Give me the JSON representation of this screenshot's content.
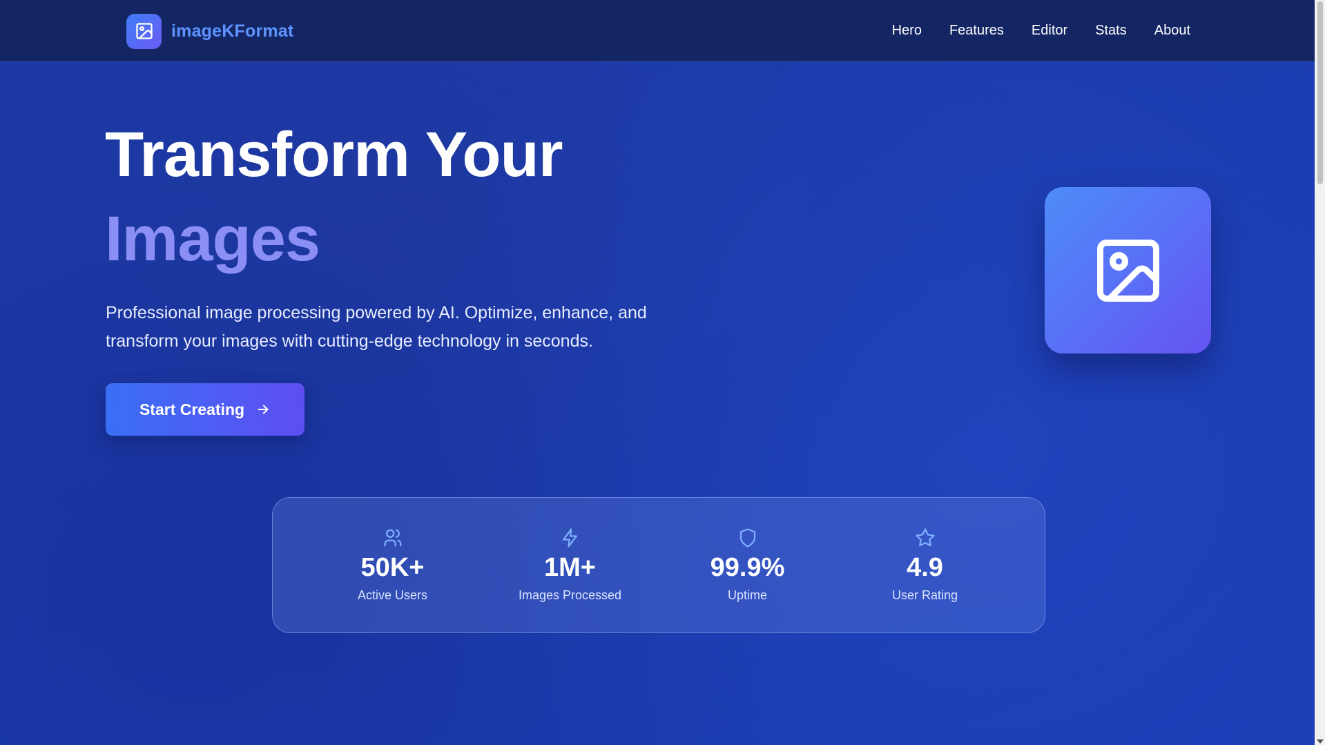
{
  "brand": {
    "name": "imageKFormat",
    "logo_icon": "image-icon"
  },
  "nav": {
    "items": [
      {
        "label": "Hero"
      },
      {
        "label": "Features"
      },
      {
        "label": "Editor"
      },
      {
        "label": "Stats"
      },
      {
        "label": "About"
      }
    ]
  },
  "hero": {
    "title_line1": "Transform Your",
    "title_line2": "Images",
    "description": "Professional image processing powered by AI. Optimize, enhance, and transform your images with cutting-edge technology in seconds.",
    "cta_label": "Start Creating",
    "cta_icon": "arrow-right-icon",
    "graphic_icon": "image-icon"
  },
  "stats": [
    {
      "icon": "users-icon",
      "value": "50K+",
      "label": "Active Users"
    },
    {
      "icon": "lightning-icon",
      "value": "1M+",
      "label": "Images Processed"
    },
    {
      "icon": "shield-icon",
      "value": "99.9%",
      "label": "Uptime"
    },
    {
      "icon": "star-icon",
      "value": "4.9",
      "label": "User Rating"
    }
  ],
  "colors": {
    "nav_bg": "#132563",
    "brand_text": "#5f94ff",
    "accent_title": "#8a8ef5",
    "cta_start": "#3a6ff5",
    "cta_end": "#5e4ef2"
  }
}
